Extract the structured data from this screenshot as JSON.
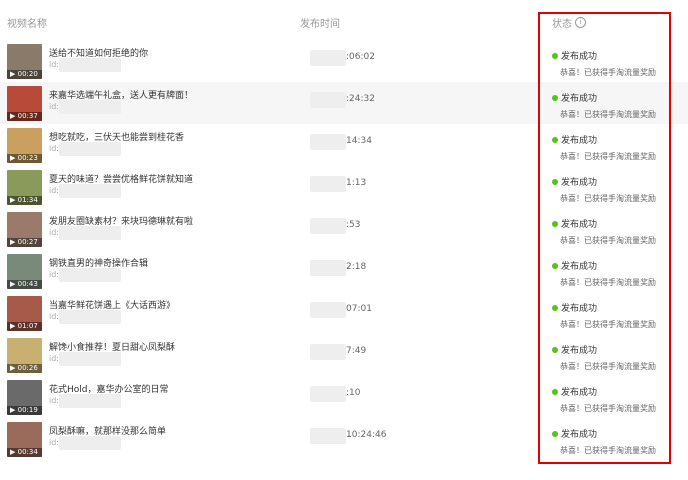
{
  "columns": {
    "video": "视频名称",
    "time": "发布时间",
    "status": "状态"
  },
  "rows": [
    {
      "title": "送给不知道如何拒绝的你",
      "id_label": "id:",
      "duration": "00:20",
      "time": ":06:02",
      "status": "发布成功",
      "sub": "恭喜！已获得手淘流量奖励",
      "thumb_color": "#8a7a6a"
    },
    {
      "title": "来嘉华选端午礼盒，送人更有牌面！",
      "id_label": "id:",
      "duration": "00:37",
      "time": ":24:32",
      "status": "发布成功",
      "sub": "恭喜！已获得手淘流量奖励",
      "thumb_color": "#b84a3a"
    },
    {
      "title": "想吃就吃，三伏天也能尝到桂花香",
      "id_label": "id:",
      "duration": "00:23",
      "time": "14:34",
      "status": "发布成功",
      "sub": "恭喜！已获得手淘流量奖励",
      "thumb_color": "#c9a060"
    },
    {
      "title": "夏天的味道？尝尝优格鲜花饼就知道",
      "id_label": "id:",
      "duration": "01:34",
      "time": "1:13",
      "status": "发布成功",
      "sub": "恭喜！已获得手淘流量奖励",
      "thumb_color": "#8a9a5a"
    },
    {
      "title": "发朋友圈缺素材？来块玛德琳就有啦",
      "id_label": "id:",
      "duration": "00:27",
      "time": ":53",
      "status": "发布成功",
      "sub": "恭喜！已获得手淘流量奖励",
      "thumb_color": "#9a7a6a"
    },
    {
      "title": "钢铁直男的神奇操作合辑",
      "id_label": "id:",
      "duration": "00:43",
      "time": "2:18",
      "status": "发布成功",
      "sub": "恭喜！已获得手淘流量奖励",
      "thumb_color": "#7a8a7a"
    },
    {
      "title": "当嘉华鲜花饼遇上《大话西游》",
      "id_label": "id:",
      "duration": "01:07",
      "time": "07:01",
      "status": "发布成功",
      "sub": "恭喜！已获得手淘流量奖励",
      "thumb_color": "#a85a4a"
    },
    {
      "title": "解馋小食推荐！夏日甜心凤梨酥",
      "id_label": "id:",
      "duration": "00:26",
      "time": "7:49",
      "status": "发布成功",
      "sub": "恭喜！已获得手淘流量奖励",
      "thumb_color": "#c8b070"
    },
    {
      "title": "花式Hold，嘉华办公室的日常",
      "id_label": "id:",
      "duration": "00:19",
      "time": ":10",
      "status": "发布成功",
      "sub": "恭喜！已获得手淘流量奖励",
      "thumb_color": "#6a6a6a"
    },
    {
      "title": "凤梨酥嘛，就那样没那么简单",
      "id_label": "id:",
      "duration": "00:34",
      "time": "10:24:46",
      "status": "发布成功",
      "sub": "恭喜！已获得手淘流量奖励",
      "thumb_color": "#9a6a5a"
    }
  ],
  "colors": {
    "highlight_border": "#e30000",
    "success_dot": "#52c41a"
  }
}
